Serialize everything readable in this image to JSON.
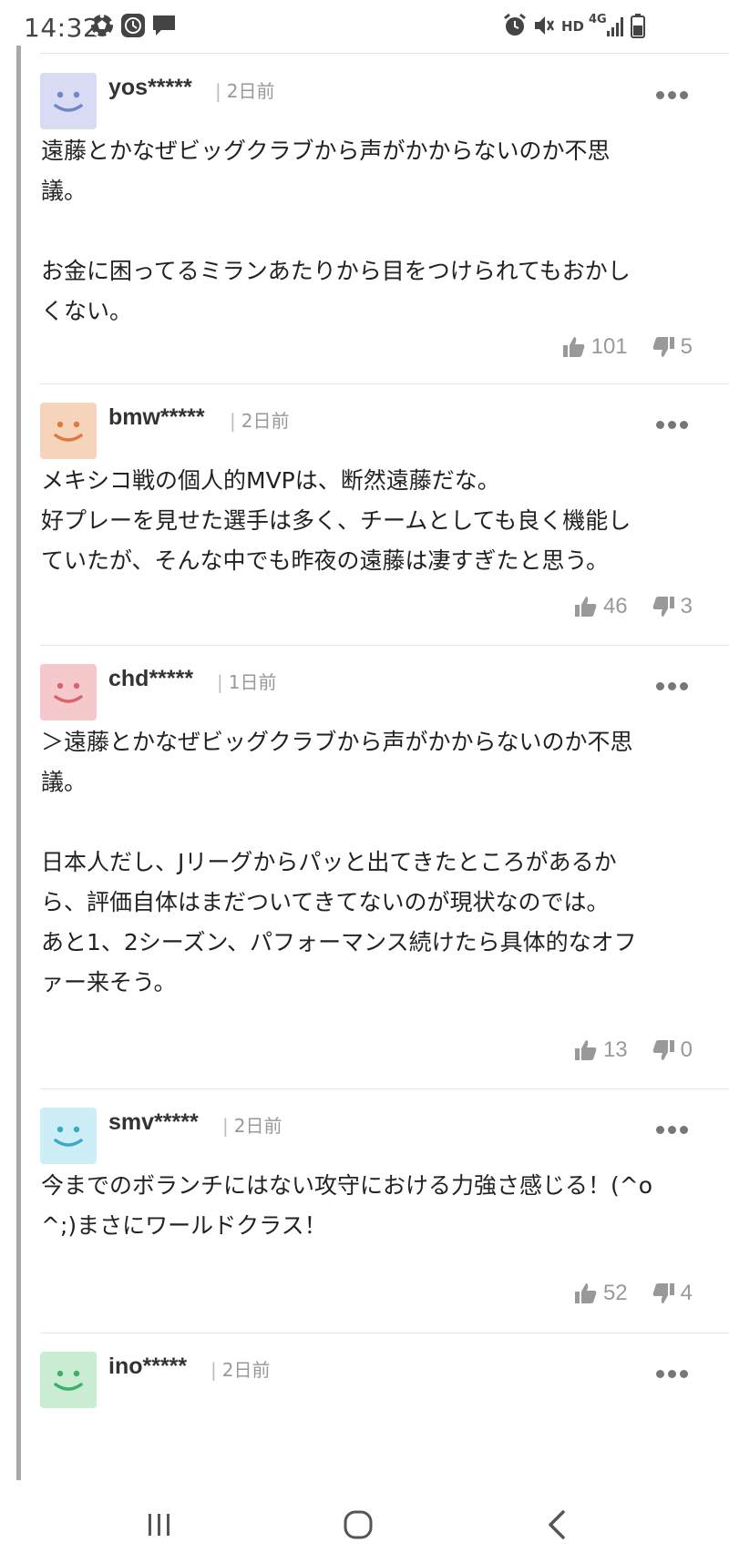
{
  "status_bar": {
    "time": "14:32",
    "network": "HD",
    "signal_type": "4G",
    "left_icons": [
      "soccer-ball-icon",
      "clock-app-icon",
      "message-icon"
    ],
    "right_icons": [
      "alarm-icon",
      "mute-icon",
      "signal-icon",
      "battery-icon"
    ]
  },
  "comments": [
    {
      "user": "yos*****",
      "time": "2日前",
      "text": "遠藤とかなぜビッグクラブから声がかからないのか不思\n議。\n\nお金に困ってるミランあたりから目をつけられてもおかし\nくない。",
      "likes": "101",
      "dislikes": "5",
      "avatar_color": "#d9dbf4",
      "face_color": "#6f86c9"
    },
    {
      "user": "bmw*****",
      "time": "2日前",
      "text": "メキシコ戦の個人的MVPは、断然遠藤だな。\n好プレーを見せた選手は多く、チームとしても良く機能し\nていたが、そんな中でも昨夜の遠藤は凄すぎたと思う。",
      "likes": "46",
      "dislikes": "3",
      "avatar_color": "#f6d4bb",
      "face_color": "#e07a3a"
    },
    {
      "user": "chd*****",
      "time": "1日前",
      "text": "＞遠藤とかなぜビッグクラブから声がかからないのか不思\n議。\n\n日本人だし、Jリーグからパッと出てきたところがあるか\nら、評価自体はまだついてきてないのが現状なのでは。\nあと1、2シーズン、パフォーマンス続けたら具体的なオフ\nァー来そう。",
      "likes": "13",
      "dislikes": "0",
      "avatar_color": "#f5c9cc",
      "face_color": "#d8646c"
    },
    {
      "user": "smv*****",
      "time": "2日前",
      "text": "今までのボランチにはない攻守における力強さ感じる！(^o\n^;)まさにワールドクラス！",
      "likes": "52",
      "dislikes": "4",
      "avatar_color": "#cdeef6",
      "face_color": "#3aa9c6"
    },
    {
      "user": "ino*****",
      "time": "2日前",
      "text": "",
      "likes": "",
      "dislikes": "",
      "avatar_color": "#c9ecd2",
      "face_color": "#3fae67"
    }
  ],
  "nav": {
    "recents": "recent-apps-icon",
    "home": "home-icon",
    "back": "back-icon"
  }
}
